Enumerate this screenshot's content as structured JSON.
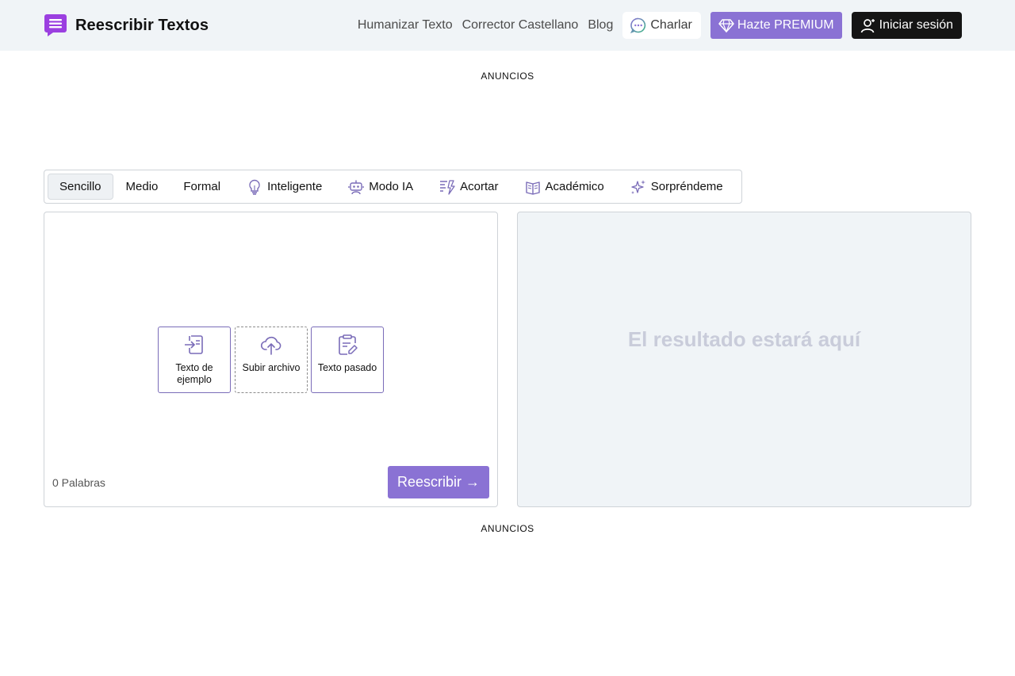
{
  "header": {
    "brand": "Reescribir Textos",
    "logo_icon": "chat-lines-icon",
    "brand_color": "#9b3fe0",
    "nav": {
      "humanize": "Humanizar Texto",
      "corrector": "Corrector Castellano",
      "blog": "Blog",
      "chat": "Charlar",
      "premium": "Hazte PREMIUM",
      "login": "Iniciar sesión"
    }
  },
  "ads_top": "ANUNCIOS",
  "ads_bottom": "ANUNCIOS",
  "modes": {
    "active": "Sencillo",
    "items": [
      {
        "label": "Sencillo",
        "icon": ""
      },
      {
        "label": "Medio",
        "icon": ""
      },
      {
        "label": "Formal",
        "icon": ""
      },
      {
        "label": "Inteligente",
        "icon": "lightbulb-icon"
      },
      {
        "label": "Modo IA",
        "icon": "robot-icon"
      },
      {
        "label": "Acortar",
        "icon": "shorten-icon"
      },
      {
        "label": "Académico",
        "icon": "book-icon"
      },
      {
        "label": "Sorpréndeme",
        "icon": "sparkles-icon"
      }
    ]
  },
  "input": {
    "quick_actions": {
      "sample": "Texto de ejemplo",
      "upload": "Subir archivo",
      "paste": "Texto pasado"
    },
    "word_count": "0 Palabras",
    "rewrite_button": "Reescribir →"
  },
  "output": {
    "placeholder": "El resultado estará aquí"
  },
  "colors": {
    "accent": "#8a72d4",
    "header_bg": "#f0f4f7",
    "login_bg": "#151515",
    "placeholder_text": "#c9ccda"
  }
}
